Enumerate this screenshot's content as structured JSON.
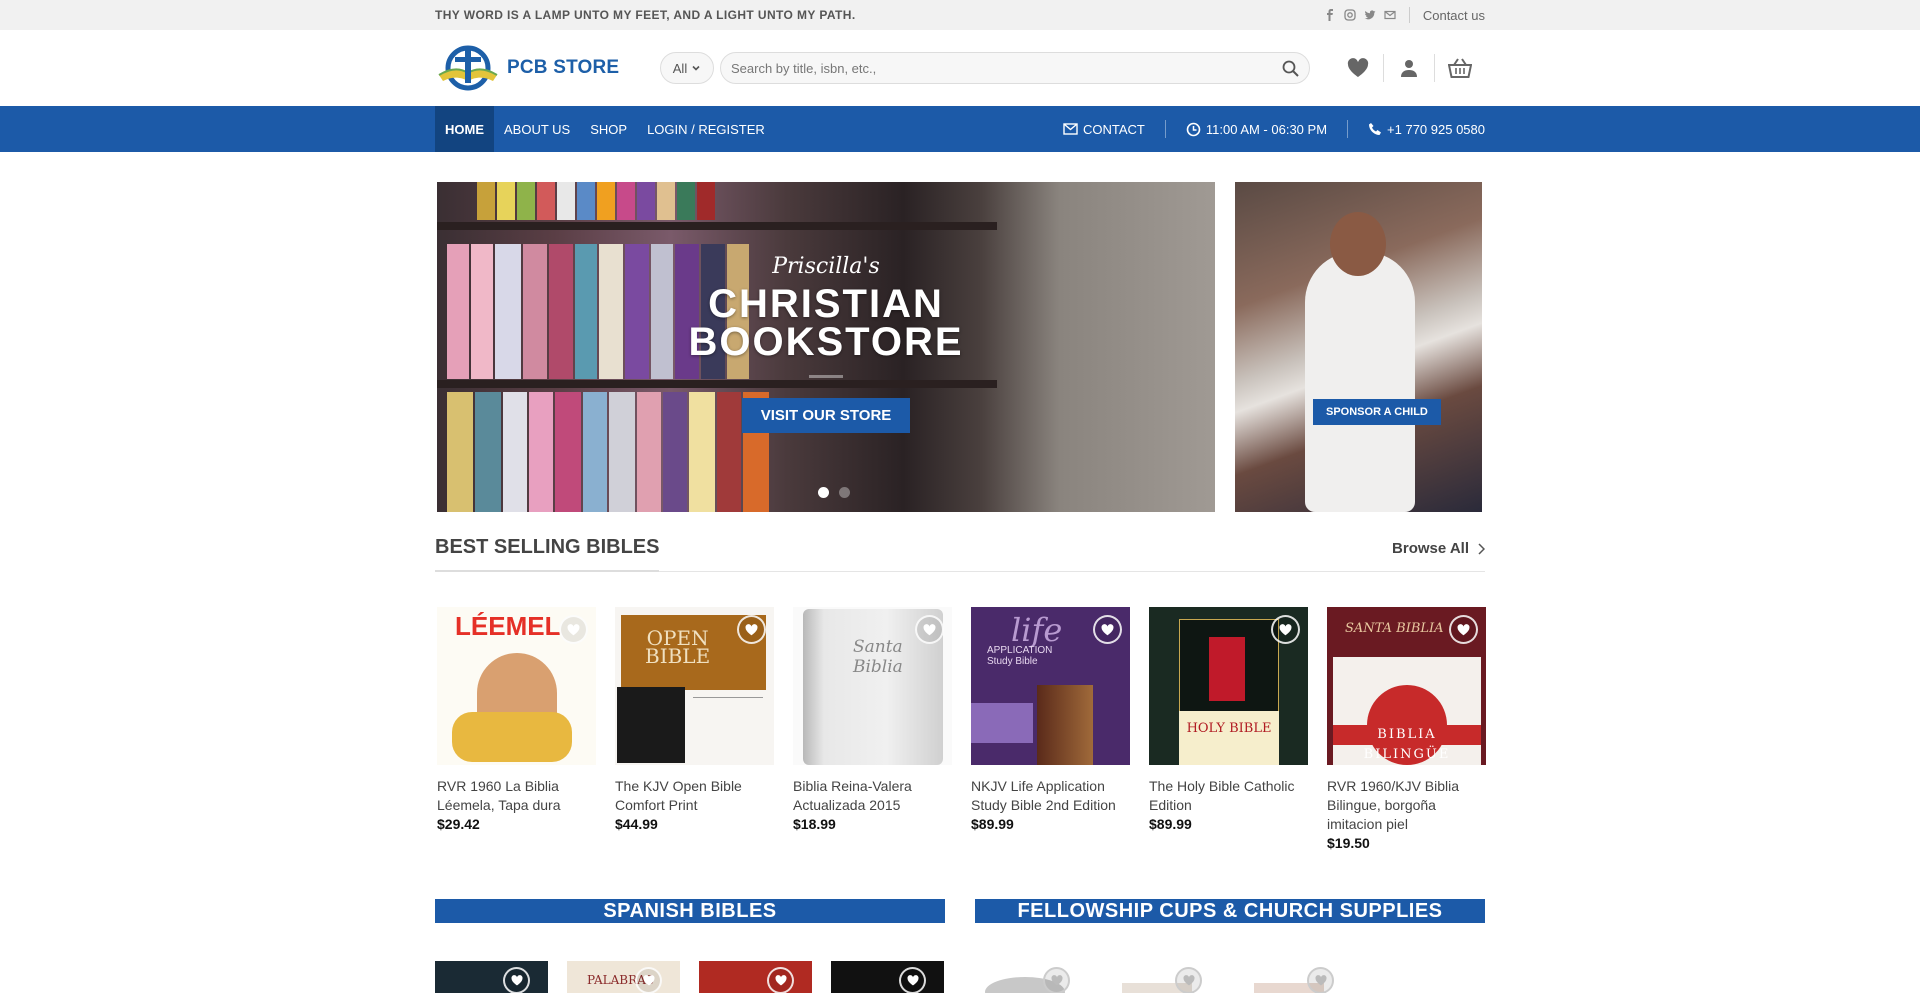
{
  "topbar": {
    "tagline": "THY WORD IS A LAMP UNTO MY FEET, AND A LIGHT UNTO MY PATH.",
    "contact_link": "Contact us",
    "social_icons": [
      "facebook-icon",
      "instagram-icon",
      "twitter-icon",
      "email-icon"
    ]
  },
  "header": {
    "logo_text": "PCB STORE",
    "search_category": "All",
    "search_placeholder": "Search by title, isbn, etc.,"
  },
  "nav": {
    "items": [
      "HOME",
      "ABOUT US",
      "SHOP",
      "LOGIN / REGISTER"
    ],
    "active": "HOME",
    "contact": "CONTACT",
    "hours": "11:00 AM - 06:30 PM",
    "phone": "+1 770 925 0580"
  },
  "hero": {
    "script": "Priscilla's",
    "title_line1": "CHRISTIAN",
    "title_line2": "BOOKSTORE",
    "button": "VISIT OUR STORE",
    "side_button": "SPONSOR A CHILD"
  },
  "best_selling": {
    "title": "BEST SELLING BIBLES",
    "browse": "Browse All",
    "products": [
      {
        "name": "RVR 1960 La Biblia Léemela, Tapa dura",
        "price": "$29.42",
        "cover": "#fdfbf4",
        "accent": "#e53027"
      },
      {
        "name": "The KJV Open Bible Comfort Print",
        "price": "$44.99",
        "cover": "#f7f5f2",
        "accent": "#b07418"
      },
      {
        "name": "Biblia Reina-Valera Actualizada 2015",
        "price": "$18.99",
        "cover": "#eeeeee",
        "accent": "#cfcfcf"
      },
      {
        "name": "NKJV Life Application Study Bible 2nd Edition",
        "price": "$89.99",
        "cover": "#4a2a6a",
        "accent": "#7a5aa0"
      },
      {
        "name": "The Holy Bible Catholic Edition",
        "price": "$89.99",
        "cover": "#1a2a22",
        "accent": "#c01a2a"
      },
      {
        "name": "RVR 1960/KJV Biblia Bilingue, borgoña imitacion piel",
        "price": "$19.50",
        "cover": "#6a1a22",
        "accent": "#c72a2a"
      }
    ]
  },
  "categories": {
    "spanish": "SPANISH BIBLES",
    "fellowship": "FELLOWSHIP CUPS & CHURCH SUPPLIES"
  }
}
